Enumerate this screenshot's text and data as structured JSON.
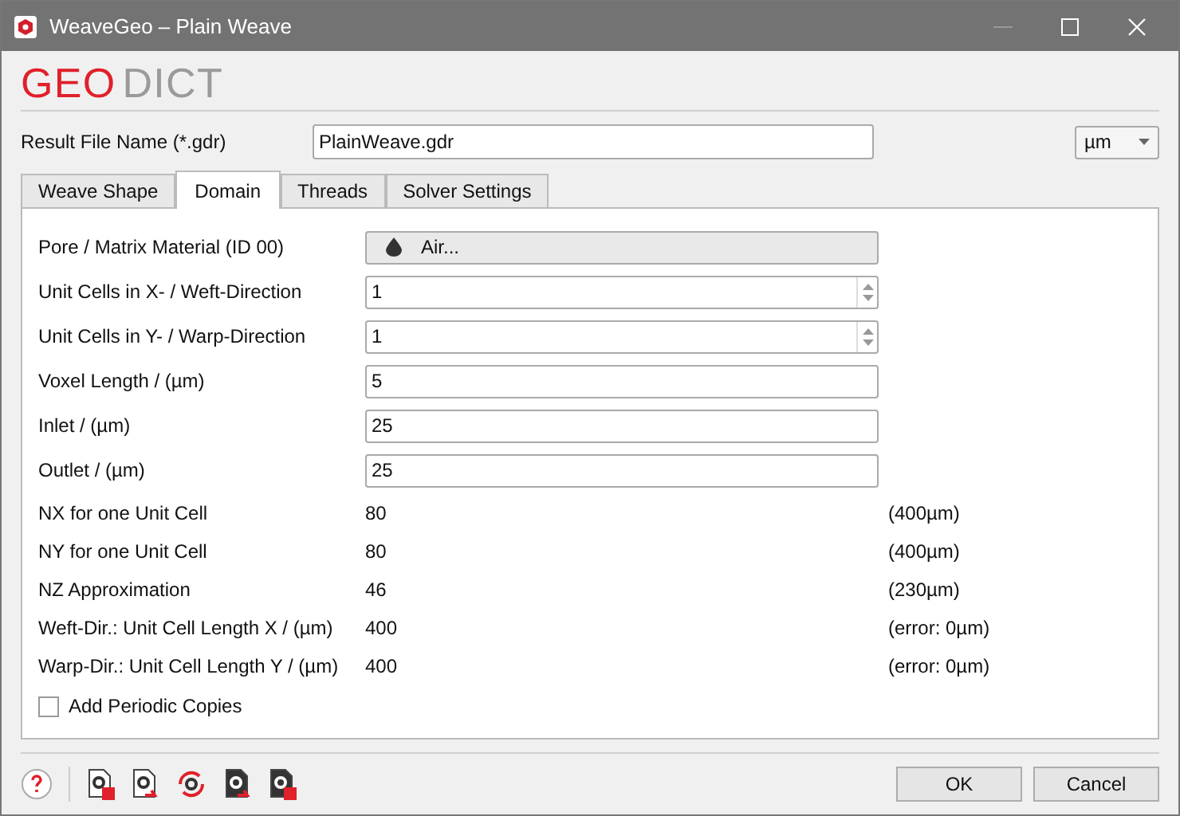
{
  "window": {
    "title": "WeaveGeo – Plain Weave"
  },
  "logo": {
    "part_1": "GEO",
    "part_2": "DICT"
  },
  "result_file": {
    "label": "Result File Name (*.gdr)",
    "value": "PlainWeave.gdr"
  },
  "unit_select": {
    "value": "µm"
  },
  "tabs": [
    {
      "label": "Weave Shape",
      "selected": false
    },
    {
      "label": "Domain",
      "selected": true
    },
    {
      "label": "Threads",
      "selected": false
    },
    {
      "label": "Solver Settings",
      "selected": false
    }
  ],
  "fields": [
    {
      "kind": "button",
      "label": "Pore / Matrix Material (ID 00)",
      "value": "Air..."
    },
    {
      "kind": "spin",
      "label": "Unit Cells in X- / Weft-Direction",
      "value": "1"
    },
    {
      "kind": "spin",
      "label": "Unit Cells in Y- / Warp-Direction",
      "value": "1"
    },
    {
      "kind": "text",
      "label": "Voxel Length / (µm)",
      "value": "5"
    },
    {
      "kind": "text",
      "label": "Inlet / (µm)",
      "value": "25"
    },
    {
      "kind": "text",
      "label": "Outlet / (µm)",
      "value": "25"
    }
  ],
  "info_rows": [
    {
      "label": "NX for one Unit Cell",
      "value": "80",
      "note": "(400µm)"
    },
    {
      "label": "NY for one Unit Cell",
      "value": "80",
      "note": "(400µm)"
    },
    {
      "label": "NZ Approximation",
      "value": "46",
      "note": "(230µm)"
    },
    {
      "label": "Weft-Dir.: Unit Cell Length X / (µm)",
      "value": "400",
      "note": "(error: 0µm)"
    },
    {
      "label": "Warp-Dir.: Unit Cell Length Y / (µm)",
      "value": "400",
      "note": "(error: 0µm)"
    }
  ],
  "periodic_copies": {
    "label": "Add Periodic Copies",
    "checked": false
  },
  "buttons": [
    {
      "label": "OK"
    },
    {
      "label": "Cancel"
    }
  ]
}
